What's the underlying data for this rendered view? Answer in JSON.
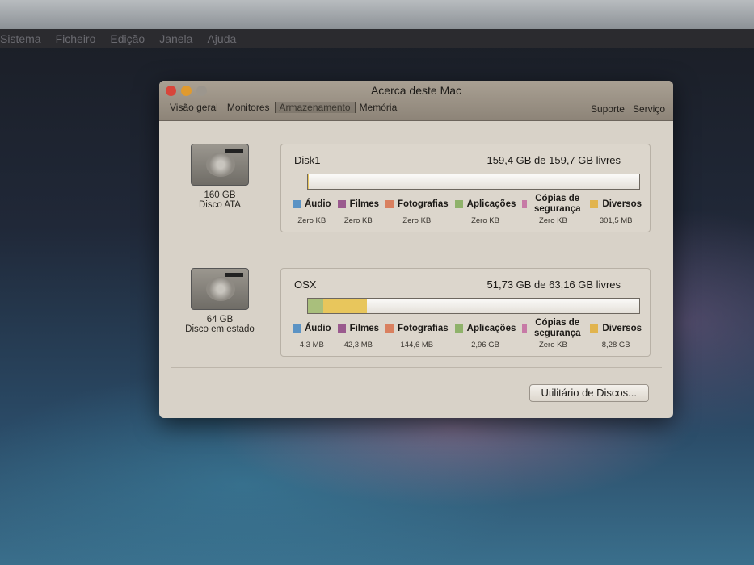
{
  "menubar": [
    "Sistema",
    "Ficheiro",
    "Edição",
    "Janela",
    "Ajuda"
  ],
  "window": {
    "title": "Acerca deste Mac",
    "tabs": [
      "Visão geral",
      "Monitores",
      "Armazenamento",
      "Memória"
    ],
    "right_tabs": [
      "Suporte",
      "Serviço"
    ],
    "utility_button": "Utilitário de Discos..."
  },
  "categories": [
    {
      "label": "Áudio",
      "color": "#5b93c4"
    },
    {
      "label": "Filmes",
      "color": "#9a5a8e"
    },
    {
      "label": "Fotografias",
      "color": "#d9805f"
    },
    {
      "label": "Aplicações",
      "color": "#8fb26a"
    },
    {
      "label": "Cópias de segurança",
      "color": "#c77aa6"
    },
    {
      "label": "Diversos",
      "color": "#e1b44e"
    }
  ],
  "disks": [
    {
      "size": "160 GB",
      "type": "Disco ATA",
      "name": "Disk1",
      "free": "159,4 GB de 159,7 GB livres",
      "values": [
        "Zero KB",
        "Zero KB",
        "Zero KB",
        "Zero KB",
        "Zero KB",
        "301,5 MB"
      ],
      "used_fraction": {
        "apps": 0,
        "misc": 0.002
      }
    },
    {
      "size": "64 GB",
      "type": "Disco em estado",
      "name": "OSX",
      "free": "51,73 GB de 63,16 GB livres",
      "values": [
        "4,3 MB",
        "42,3 MB",
        "144,6 MB",
        "2,96 GB",
        "Zero KB",
        "8,28 GB"
      ],
      "used_fraction": {
        "apps": 0.047,
        "misc": 0.131
      }
    }
  ]
}
